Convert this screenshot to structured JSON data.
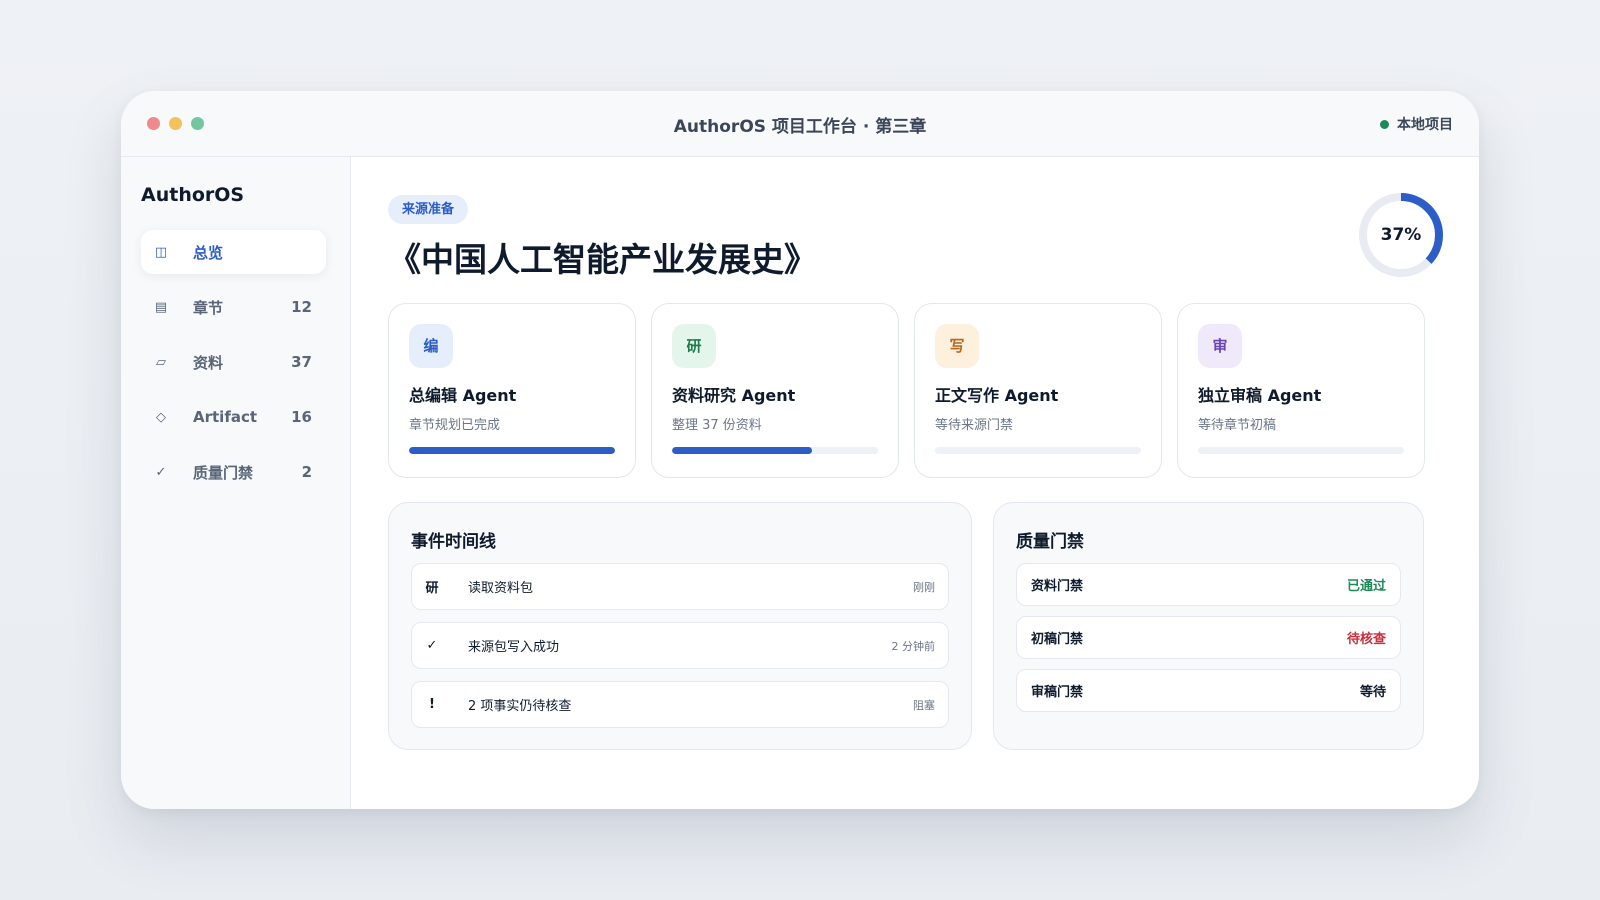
{
  "window": {
    "title": "AuthorOS 项目工作台 · 第三章",
    "project_status": {
      "label": "本地项目",
      "color": "#1e8a5a"
    }
  },
  "sidebar": {
    "brand": "AuthorOS",
    "items": [
      {
        "icon": "layout-icon",
        "glyph": "◫",
        "label": "总览",
        "count": "",
        "active": true
      },
      {
        "icon": "chapters-icon",
        "glyph": "▤",
        "label": "章节",
        "count": "12",
        "active": false
      },
      {
        "icon": "materials-icon",
        "glyph": "▱",
        "label": "资料",
        "count": "37",
        "active": false
      },
      {
        "icon": "diamond-icon",
        "glyph": "◇",
        "label": "Artifact",
        "count": "16",
        "active": false
      },
      {
        "icon": "check-icon",
        "glyph": "✓",
        "label": "质量门禁",
        "count": "2",
        "active": false
      }
    ]
  },
  "header": {
    "stage_badge": "来源准备",
    "book_title": "《中国人工智能产业发展史》",
    "progress": {
      "value": 0.37,
      "label": "37%",
      "color": "#2d5dc7"
    }
  },
  "agents": [
    {
      "icon_text": "编",
      "name": "总编辑 Agent",
      "status": "章节规划已完成",
      "progress": 1.0,
      "icon_bg": "#e6eefc",
      "icon_color": "#2d5dc7"
    },
    {
      "icon_text": "研",
      "name": "资料研究 Agent",
      "status": "整理 37 份资料",
      "progress": 0.68,
      "icon_bg": "#e4f5ec",
      "icon_color": "#1e7a4c"
    },
    {
      "icon_text": "写",
      "name": "正文写作 Agent",
      "status": "等待来源门禁",
      "progress": 0.0,
      "icon_bg": "#fdf0dd",
      "icon_color": "#b8661a"
    },
    {
      "icon_text": "审",
      "name": "独立审稿 Agent",
      "status": "等待章节初稿",
      "progress": 0.0,
      "icon_bg": "#efe9fb",
      "icon_color": "#6a45b5"
    }
  ],
  "timeline": {
    "title": "事件时间线",
    "events": [
      {
        "icon": "research-icon",
        "glyph": "研",
        "label": "读取资料包",
        "time": "刚刚"
      },
      {
        "icon": "check-icon",
        "glyph": "✓",
        "label": "来源包写入成功",
        "time": "2 分钟前"
      },
      {
        "icon": "alert-icon",
        "glyph": "!",
        "label": "2 项事实仍待核查",
        "time": "阻塞"
      }
    ]
  },
  "gates": {
    "title": "质量门禁",
    "items": [
      {
        "label": "资料门禁",
        "status": "已通过",
        "color": "#1e8a5a"
      },
      {
        "label": "初稿门禁",
        "status": "待核查",
        "color": "#c8303d"
      },
      {
        "label": "审稿门禁",
        "status": "等待",
        "color": "#0f1b2d"
      }
    ]
  }
}
